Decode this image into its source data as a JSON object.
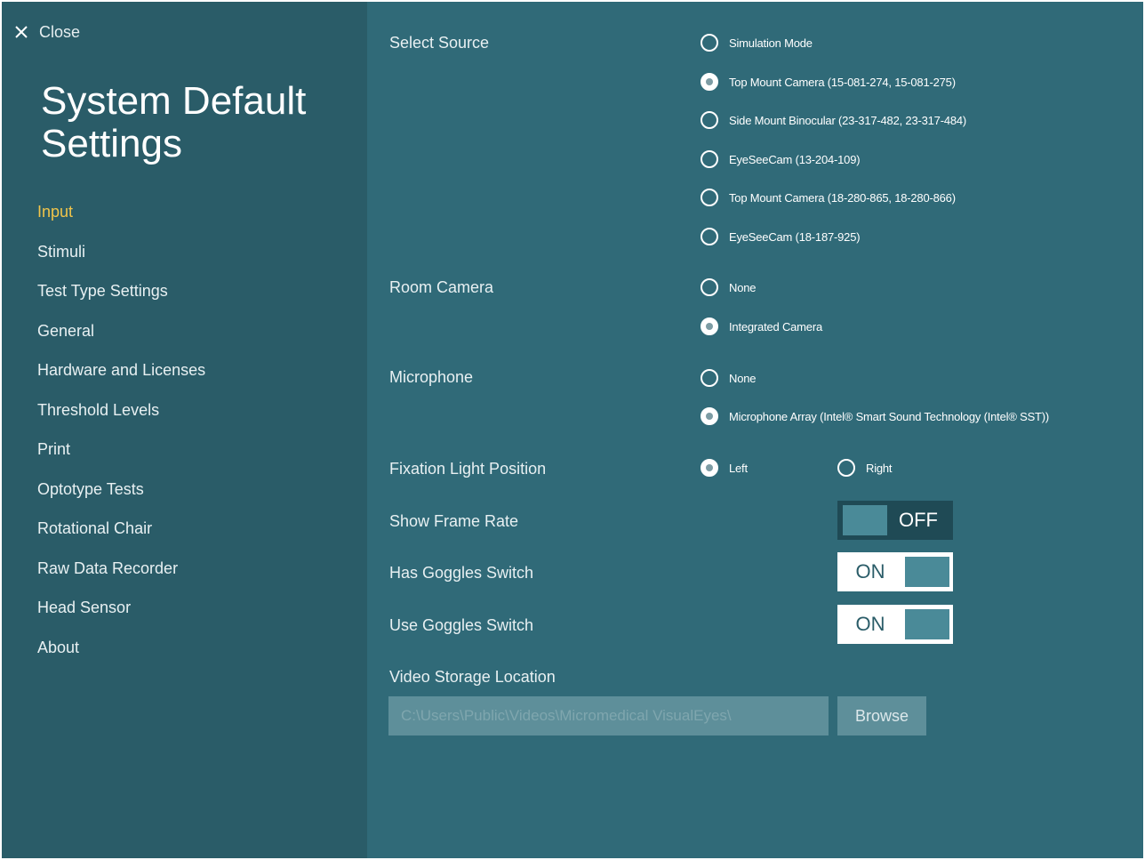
{
  "close": {
    "label": "Close",
    "icon": "close-icon"
  },
  "title": "System Default Settings",
  "nav": [
    {
      "label": "Input",
      "active": true
    },
    {
      "label": "Stimuli",
      "active": false
    },
    {
      "label": "Test Type Settings",
      "active": false
    },
    {
      "label": "General",
      "active": false
    },
    {
      "label": "Hardware and Licenses",
      "active": false
    },
    {
      "label": "Threshold Levels",
      "active": false
    },
    {
      "label": "Print",
      "active": false
    },
    {
      "label": "Optotype Tests",
      "active": false
    },
    {
      "label": "Rotational Chair",
      "active": false
    },
    {
      "label": "Raw Data Recorder",
      "active": false
    },
    {
      "label": "Head Sensor",
      "active": false
    },
    {
      "label": "About",
      "active": false
    }
  ],
  "select_source": {
    "label": "Select Source",
    "options": [
      {
        "label": "Simulation Mode",
        "checked": false
      },
      {
        "label": "Top Mount Camera   (15-081-274, 15-081-275)",
        "checked": true
      },
      {
        "label": "Side Mount Binocular   (23-317-482, 23-317-484)",
        "checked": false
      },
      {
        "label": "EyeSeeCam   (13-204-109)",
        "checked": false
      },
      {
        "label": "Top Mount Camera   (18-280-865, 18-280-866)",
        "checked": false
      },
      {
        "label": "EyeSeeCam   (18-187-925)",
        "checked": false
      }
    ]
  },
  "room_camera": {
    "label": "Room Camera",
    "options": [
      {
        "label": "None",
        "checked": false
      },
      {
        "label": "Integrated Camera",
        "checked": true
      }
    ]
  },
  "microphone": {
    "label": "Microphone",
    "options": [
      {
        "label": "None",
        "checked": false
      },
      {
        "label": "Microphone Array (Intel® Smart Sound Technology (Intel® SST))",
        "checked": true
      }
    ]
  },
  "fixation": {
    "label": "Fixation Light Position",
    "options": [
      {
        "label": "Left",
        "checked": true
      },
      {
        "label": "Right",
        "checked": false
      }
    ]
  },
  "show_frame_rate": {
    "label": "Show Frame Rate",
    "state": "OFF"
  },
  "has_goggles_switch": {
    "label": "Has Goggles Switch",
    "state": "ON"
  },
  "use_goggles_switch": {
    "label": "Use Goggles Switch",
    "state": "ON"
  },
  "video_storage": {
    "label": "Video Storage Location",
    "value": "C:\\Users\\Public\\Videos\\Micromedical VisualEyes\\",
    "browse_label": "Browse"
  },
  "colors": {
    "sidebar": "#2a5c68",
    "main": "#306a78",
    "active_nav": "#f0c44a"
  }
}
